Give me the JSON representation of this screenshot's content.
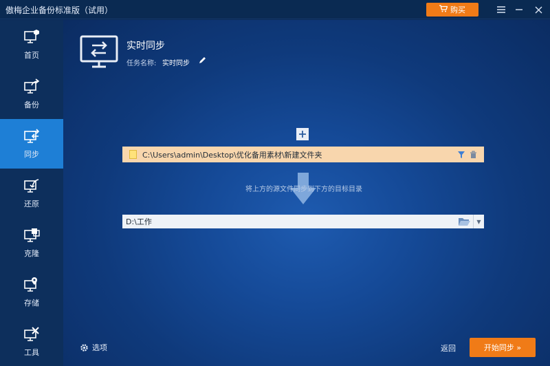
{
  "app": {
    "title": "傲梅企业备份标准版（试用）",
    "buy_label": "购买",
    "accent_color": "#f07b17"
  },
  "window_controls": {
    "menu_icon": "menu-icon",
    "minimize_icon": "minimize-icon",
    "close_icon": "close-icon"
  },
  "sidebar": {
    "items": [
      {
        "label": "首页",
        "icon": "home-monitor-icon",
        "active": false
      },
      {
        "label": "备份",
        "icon": "backup-icon",
        "active": false
      },
      {
        "label": "同步",
        "icon": "sync-icon",
        "active": true
      },
      {
        "label": "还原",
        "icon": "restore-icon",
        "active": false
      },
      {
        "label": "克隆",
        "icon": "clone-icon",
        "active": false
      },
      {
        "label": "存储",
        "icon": "storage-icon",
        "active": false
      },
      {
        "label": "工具",
        "icon": "tools-icon",
        "active": false
      }
    ]
  },
  "main": {
    "title": "实时同步",
    "task_label": "任务名称:",
    "task_name": "实时同步",
    "source": {
      "path": "C:\\Users\\admin\\Desktop\\优化备用素材\\新建文件夹"
    },
    "hint": "将上方的源文件同步到下方的目标目录",
    "destination": {
      "path": "D:\\工作"
    },
    "options_label": "选项",
    "back_label": "返回",
    "start_label": "开始同步 »"
  }
}
